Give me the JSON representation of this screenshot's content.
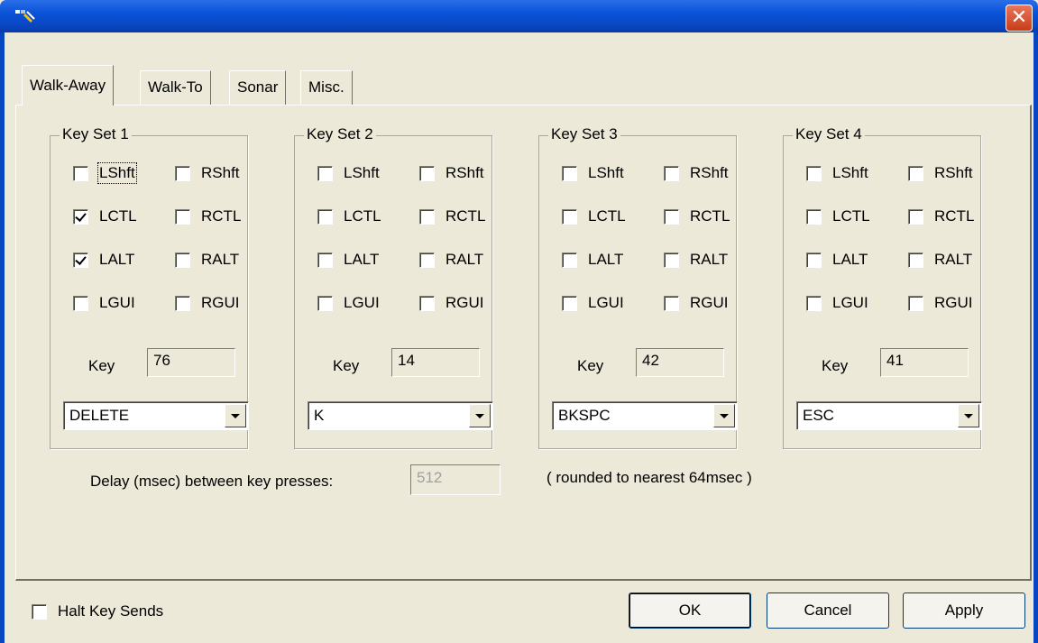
{
  "window": {
    "title": ""
  },
  "tabs": [
    "Walk-Away",
    "Walk-To",
    "Sonar",
    "Misc."
  ],
  "key_sets": [
    {
      "title": "Key Set 1",
      "mods": [
        {
          "label": "LShft",
          "checked": false
        },
        {
          "label": "RShft",
          "checked": false
        },
        {
          "label": "LCTL",
          "checked": true
        },
        {
          "label": "RCTL",
          "checked": false
        },
        {
          "label": "LALT",
          "checked": true
        },
        {
          "label": "RALT",
          "checked": false
        },
        {
          "label": "LGUI",
          "checked": false
        },
        {
          "label": "RGUI",
          "checked": false
        }
      ],
      "key_label": "Key",
      "key_value": "76",
      "selected": "DELETE"
    },
    {
      "title": "Key Set 2",
      "mods": [
        {
          "label": "LShft",
          "checked": false
        },
        {
          "label": "RShft",
          "checked": false
        },
        {
          "label": "LCTL",
          "checked": false
        },
        {
          "label": "RCTL",
          "checked": false
        },
        {
          "label": "LALT",
          "checked": false
        },
        {
          "label": "RALT",
          "checked": false
        },
        {
          "label": "LGUI",
          "checked": false
        },
        {
          "label": "RGUI",
          "checked": false
        }
      ],
      "key_label": "Key",
      "key_value": "14",
      "selected": "K"
    },
    {
      "title": "Key Set 3",
      "mods": [
        {
          "label": "LShft",
          "checked": false
        },
        {
          "label": "RShft",
          "checked": false
        },
        {
          "label": "LCTL",
          "checked": false
        },
        {
          "label": "RCTL",
          "checked": false
        },
        {
          "label": "LALT",
          "checked": false
        },
        {
          "label": "RALT",
          "checked": false
        },
        {
          "label": "LGUI",
          "checked": false
        },
        {
          "label": "RGUI",
          "checked": false
        }
      ],
      "key_label": "Key",
      "key_value": "42",
      "selected": "BKSPC"
    },
    {
      "title": "Key Set 4",
      "mods": [
        {
          "label": "LShft",
          "checked": false
        },
        {
          "label": "RShft",
          "checked": false
        },
        {
          "label": "LCTL",
          "checked": false
        },
        {
          "label": "RCTL",
          "checked": false
        },
        {
          "label": "LALT",
          "checked": false
        },
        {
          "label": "RALT",
          "checked": false
        },
        {
          "label": "LGUI",
          "checked": false
        },
        {
          "label": "RGUI",
          "checked": false
        }
      ],
      "key_label": "Key",
      "key_value": "41",
      "selected": "ESC"
    }
  ],
  "delay": {
    "label": "Delay (msec) between key presses:",
    "value": "512",
    "note": "( rounded to nearest 64msec )"
  },
  "halt": {
    "label": "Halt Key Sends",
    "checked": false
  },
  "buttons": {
    "ok": "OK",
    "cancel": "Cancel",
    "apply": "Apply"
  },
  "icons": {
    "app": "app-icon",
    "close": "close-icon",
    "dropdown": "dropdown-arrow-icon"
  }
}
